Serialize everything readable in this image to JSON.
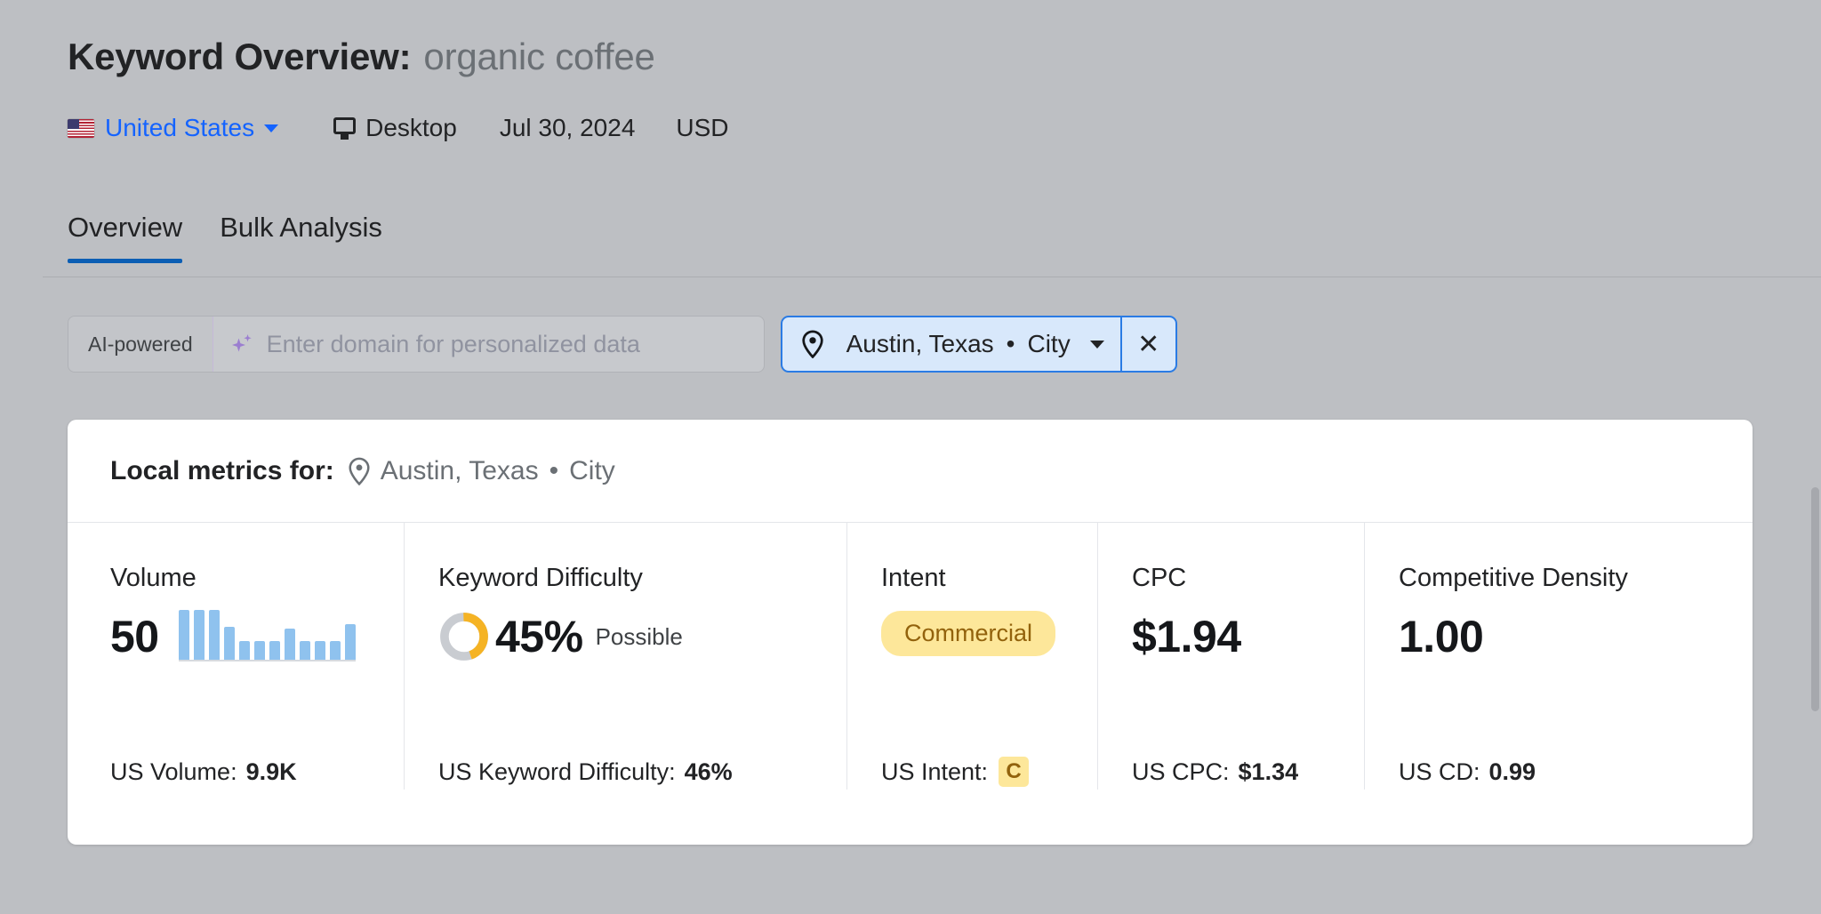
{
  "header": {
    "title_label": "Keyword Overview:",
    "keyword": "organic coffee",
    "country": "United States",
    "device": "Desktop",
    "date": "Jul 30, 2024",
    "currency": "USD"
  },
  "tabs": [
    {
      "label": "Overview",
      "active": true
    },
    {
      "label": "Bulk Analysis",
      "active": false
    }
  ],
  "search": {
    "ai_label": "AI-powered",
    "domain_placeholder": "Enter domain for personalized data",
    "domain_value": "",
    "location_city": "Austin, Texas",
    "location_separator": "•",
    "location_type": "City",
    "close_label": "✕"
  },
  "card": {
    "header_label": "Local metrics for:",
    "header_city": "Austin, Texas",
    "header_separator": "•",
    "header_type": "City"
  },
  "metrics": {
    "volume": {
      "label": "Volume",
      "value": "50",
      "sub_label": "US Volume:",
      "sub_value": "9.9K"
    },
    "keyword_difficulty": {
      "label": "Keyword Difficulty",
      "value": "45%",
      "suffix": "Possible",
      "percent": 45,
      "sub_label": "US Keyword Difficulty:",
      "sub_value": "46%"
    },
    "intent": {
      "label": "Intent",
      "value": "Commercial",
      "sub_label": "US Intent:",
      "sub_value": "C"
    },
    "cpc": {
      "label": "CPC",
      "value": "$1.94",
      "sub_label": "US CPC:",
      "sub_value": "$1.34"
    },
    "competitive_density": {
      "label": "Competitive Density",
      "value": "1.00",
      "sub_label": "US CD:",
      "sub_value": "0.99"
    }
  },
  "chart_data": {
    "type": "bar",
    "title": "Volume trend sparkline",
    "categories": [
      "1",
      "2",
      "3",
      "4",
      "5",
      "6",
      "7",
      "8",
      "9",
      "10",
      "11",
      "12"
    ],
    "values": [
      100,
      100,
      100,
      66,
      38,
      38,
      38,
      62,
      38,
      38,
      38,
      72
    ],
    "ylim": [
      0,
      100
    ],
    "xlabel": "",
    "ylabel": "",
    "grid": false
  },
  "colors": {
    "accent_blue": "#0b5eb4",
    "link_blue": "#1463ff",
    "chip_border": "#2a7be4",
    "chip_bg": "#d8e8fb",
    "spark_bar": "#8fc2ee",
    "donut_arc": "#f5b324",
    "donut_track": "#c9ccd1",
    "badge_bg": "#fde79a",
    "badge_text": "#92620c",
    "page_bg": "#bdbfc3"
  }
}
